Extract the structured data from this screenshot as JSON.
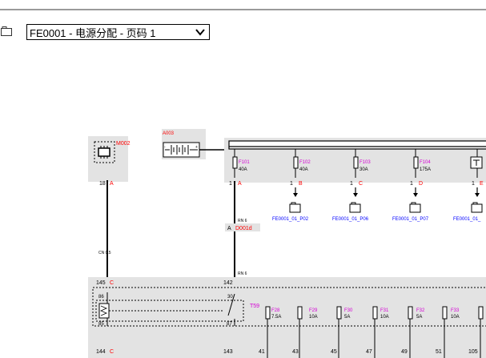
{
  "page_selector": {
    "value": "FE0001 - 电源分配 - 页码 1"
  },
  "icons": {
    "page": "page-icon",
    "dropdown": "chevron-down-icon",
    "module": "module-chip-icon",
    "battery": "battery-icon",
    "fuse": "fuse-icon",
    "page_link": "page-link-icon"
  },
  "colors": {
    "wire": "#000000",
    "ref_text": "#ff0000",
    "component_text": "#d400d4",
    "link_text": "#0000ff",
    "module_bg": "#e3e3e3"
  },
  "components": {
    "module": {
      "id": "M002",
      "pin_no": "18",
      "pin": "A"
    },
    "battery": {
      "id": "A003"
    }
  },
  "fuses_top": [
    {
      "id": "F101",
      "rating": "40A",
      "pin_no": "1",
      "pin": "A"
    },
    {
      "id": "F102",
      "rating": "40A",
      "pin_no": "1",
      "pin": "B",
      "link": "FE0001_01_P02"
    },
    {
      "id": "F103",
      "rating": "30A",
      "pin_no": "1",
      "pin": "C",
      "link": "FE0001_01_P06"
    },
    {
      "id": "F104",
      "rating": "175A",
      "pin_no": "1",
      "pin": "D",
      "link": "FE0001_01_P07"
    },
    {
      "id": "",
      "rating": "",
      "pin_no": "1",
      "pin": "E",
      "link": "FE0001_01_"
    }
  ],
  "wires": {
    "m002_down": "CN 0.5",
    "f101_down": "RN 6",
    "f101_below_conn": "RN 6",
    "conn_pin": "A",
    "conn_id": "D001d"
  },
  "relay": {
    "id": "T59",
    "pins": {
      "p86": "86",
      "p85": "85",
      "p30": "30",
      "p87": "87"
    }
  },
  "fuse_box_entry": {
    "left_pin_no": "145",
    "left_pin": "C",
    "right_pin_no": "142"
  },
  "fuses_bottom": [
    {
      "id": "F28",
      "rating": "7.5A"
    },
    {
      "id": "F29",
      "rating": "10A"
    },
    {
      "id": "F30",
      "rating": "5A"
    },
    {
      "id": "F31",
      "rating": "10A"
    },
    {
      "id": "F32",
      "rating": "5A"
    },
    {
      "id": "F33",
      "rating": "10A"
    }
  ],
  "bottom_pins": [
    {
      "no": "144",
      "pin": "C"
    },
    {
      "no": "143",
      "pin": ""
    },
    {
      "no": "41",
      "pin": ""
    },
    {
      "no": "43",
      "pin": ""
    },
    {
      "no": "45",
      "pin": ""
    },
    {
      "no": "47",
      "pin": ""
    },
    {
      "no": "49",
      "pin": ""
    },
    {
      "no": "51",
      "pin": ""
    },
    {
      "no": "105",
      "pin": ""
    }
  ]
}
